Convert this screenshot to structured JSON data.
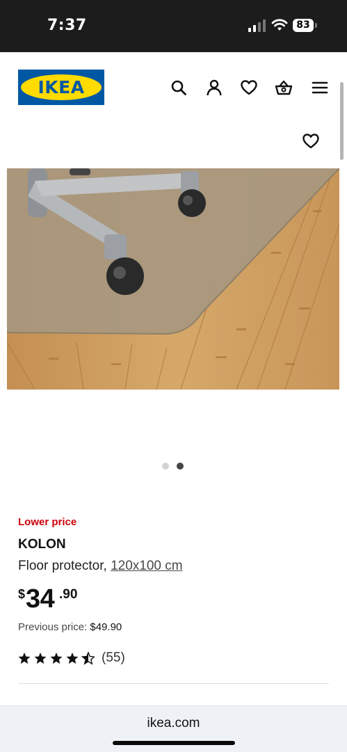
{
  "status_bar": {
    "time": "7:37",
    "battery_level": "83"
  },
  "header": {
    "logo_text": "IKEA",
    "icons": [
      "search-icon",
      "account-icon",
      "heart-icon",
      "basket-icon",
      "menu-icon"
    ]
  },
  "carousel": {
    "image_count": 2,
    "active_index": 1
  },
  "product": {
    "badge": "Lower price",
    "name": "KOLON",
    "description": "Floor protector, ",
    "size": "120x100 cm",
    "price_currency": "$",
    "price_integer": "34",
    "price_decimal": ".90",
    "previous_price_label": "Previous price: ",
    "previous_price": "$49.90",
    "rating_stars": 4.5,
    "rating_count": "(55)"
  },
  "browser": {
    "url": "ikea.com"
  },
  "colors": {
    "ikea_blue": "#0058a3",
    "ikea_yellow": "#ffdb00",
    "badge_red": "#cc0008"
  }
}
